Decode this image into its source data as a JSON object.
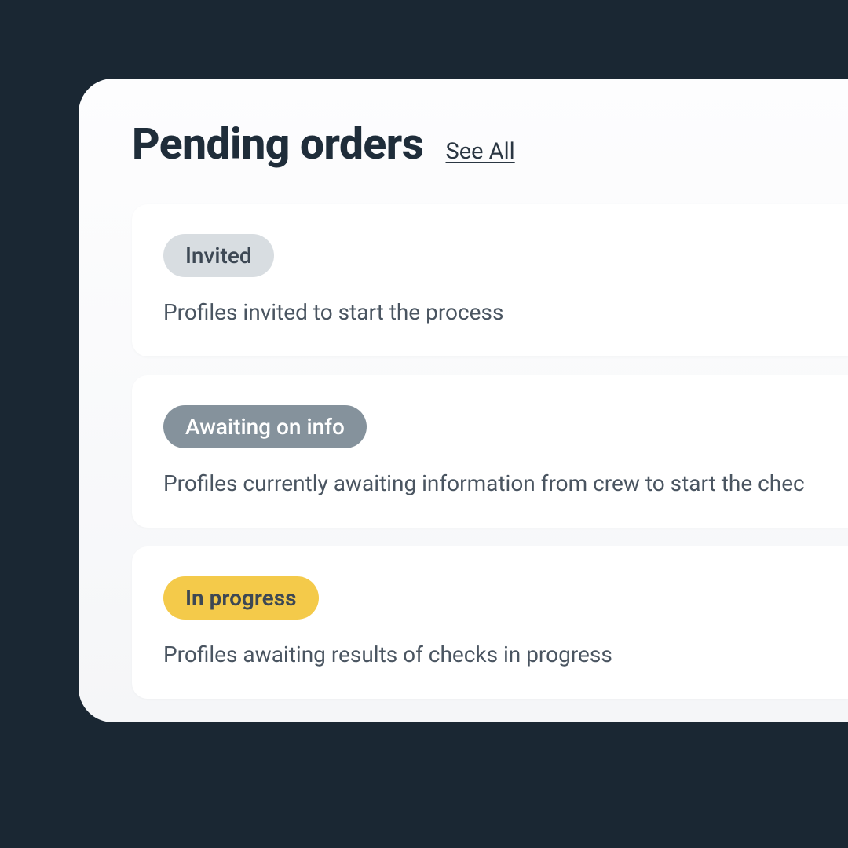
{
  "header": {
    "title": "Pending orders",
    "see_all": "See All"
  },
  "cards": [
    {
      "badge": "Invited",
      "badge_style": "invited",
      "description": "Profiles invited to start the process"
    },
    {
      "badge": "Awaiting on info",
      "badge_style": "awaiting",
      "description": "Profiles currently awaiting information from crew to start the chec"
    },
    {
      "badge": "In progress",
      "badge_style": "progress",
      "description": "Profiles awaiting results of checks in progress"
    }
  ]
}
